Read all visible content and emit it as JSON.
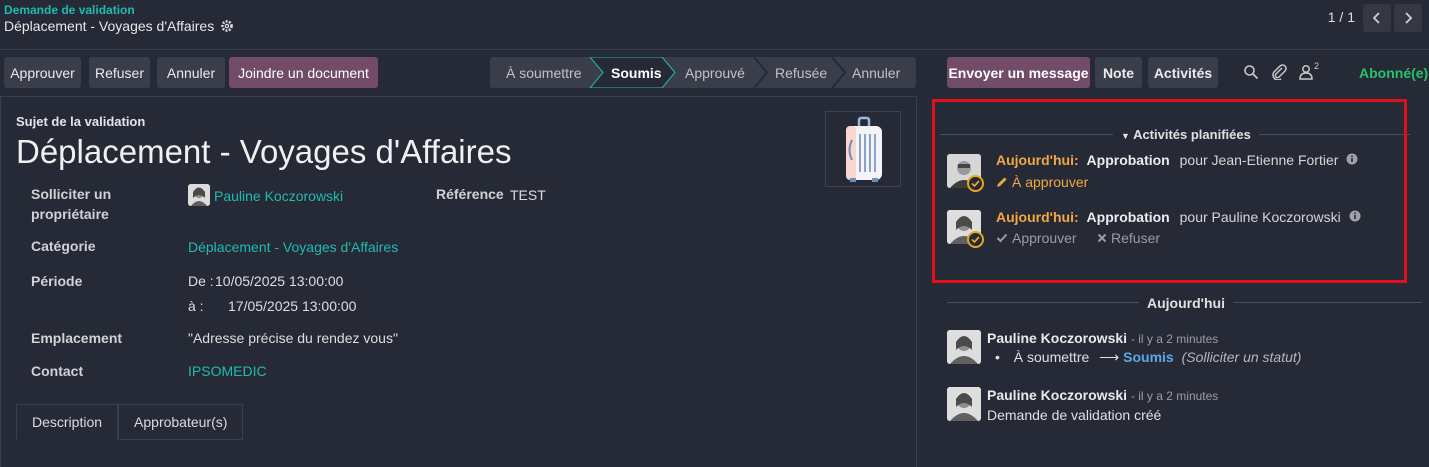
{
  "header": {
    "breadcrumb_parent": "Demande de validation",
    "breadcrumb_current": "Déplacement - Voyages d'Affaires",
    "pager": "1 / 1"
  },
  "actions": {
    "approve": "Approuver",
    "refuse": "Refuser",
    "cancel": "Annuler",
    "attach": "Joindre un document"
  },
  "statusbar": {
    "stages": [
      "À soumettre",
      "Soumis",
      "Approuvé",
      "Refusée",
      "Annuler"
    ],
    "active_index": 1
  },
  "form": {
    "subject_label": "Sujet de la validation",
    "title": "Déplacement - Voyages d'Affaires",
    "owner_label_1": "Solliciter un",
    "owner_label_2": "propriétaire",
    "owner_value": "Pauline Koczorowski",
    "reference_label": "Référence",
    "reference_value": "TEST",
    "category_label": "Catégorie",
    "category_value": "Déplacement - Voyages d'Affaires",
    "period_label": "Période",
    "period_from_prefix": "De :",
    "period_from": "10/05/2025 13:00:00",
    "period_to_prefix": "à :",
    "period_to": "17/05/2025 13:00:00",
    "location_label": "Emplacement",
    "location_value": "\"Adresse précise du rendez vous\"",
    "contact_label": "Contact",
    "contact_value": "IPSOMEDIC"
  },
  "tabs": [
    "Description",
    "Approbateur(s)"
  ],
  "chatter": {
    "send_message": "Envoyer un message",
    "note": "Note",
    "activities": "Activités",
    "followers_count": "2",
    "follow_status": "Abonné(e)",
    "planned_title": "Activités planifiées",
    "activities_list": [
      {
        "when": "Aujourd'hui:",
        "type": "Approbation",
        "for": "pour Jean-Etienne Fortier",
        "action": "À approuver"
      },
      {
        "when": "Aujourd'hui:",
        "type": "Approbation",
        "for": "pour Pauline Koczorowski",
        "approve": "Approuver",
        "refuse": "Refuser"
      }
    ],
    "today_separator": "Aujourd'hui",
    "messages": [
      {
        "author": "Pauline Koczorowski",
        "time": "- il y a 2 minutes",
        "from": "À soumettre",
        "arrow": "⟶",
        "to": "Soumis",
        "field": "(Solliciter un statut)"
      },
      {
        "author": "Pauline Koczorowski",
        "time": "- il y a 2 minutes",
        "body": "Demande de validation créé"
      }
    ]
  },
  "colors": {
    "accent": "#714b67",
    "link": "#1fbcae",
    "today": "#f0a942",
    "follow": "#25c36a",
    "highlight": "#e0101a"
  }
}
